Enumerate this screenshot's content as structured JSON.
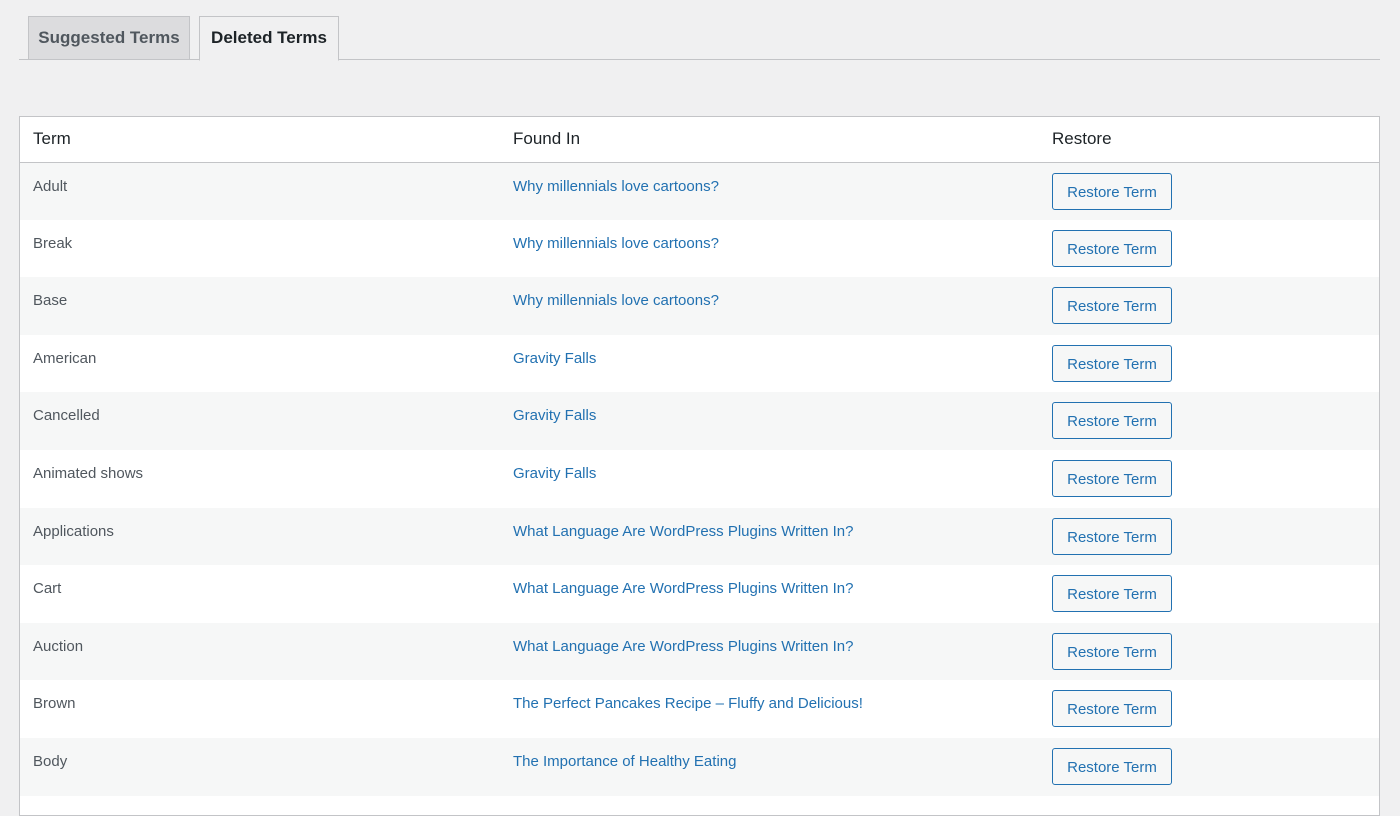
{
  "tabs": {
    "suggested": "Suggested Terms",
    "deleted": "Deleted Terms"
  },
  "table": {
    "headers": {
      "term": "Term",
      "found_in": "Found In",
      "restore": "Restore"
    },
    "rows": [
      {
        "term": "Adult",
        "found_in": "Why millennials love cartoons?",
        "action": "Restore Term"
      },
      {
        "term": "Break",
        "found_in": "Why millennials love cartoons?",
        "action": "Restore Term"
      },
      {
        "term": "Base",
        "found_in": "Why millennials love cartoons?",
        "action": "Restore Term"
      },
      {
        "term": "American",
        "found_in": "Gravity Falls",
        "action": "Restore Term"
      },
      {
        "term": "Cancelled",
        "found_in": "Gravity Falls",
        "action": "Restore Term"
      },
      {
        "term": "Animated shows",
        "found_in": "Gravity Falls",
        "action": "Restore Term"
      },
      {
        "term": "Applications",
        "found_in": "What Language Are WordPress Plugins Written In?",
        "action": "Restore Term"
      },
      {
        "term": "Cart",
        "found_in": "What Language Are WordPress Plugins Written In?",
        "action": "Restore Term"
      },
      {
        "term": "Auction",
        "found_in": "What Language Are WordPress Plugins Written In?",
        "action": "Restore Term"
      },
      {
        "term": "Brown",
        "found_in": "The Perfect Pancakes Recipe – Fluffy and Delicious!",
        "action": "Restore Term"
      },
      {
        "term": "Body",
        "found_in": "The Importance of Healthy Eating",
        "action": "Restore Term"
      }
    ]
  },
  "colors": {
    "link": "#2271b1",
    "background": "#f0f0f1",
    "row_alt": "#f6f7f7",
    "border": "#c3c4c7"
  }
}
